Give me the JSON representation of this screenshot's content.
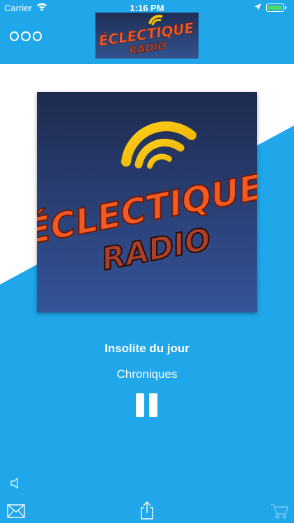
{
  "status_bar": {
    "carrier": "Carrier",
    "time": "1:16 PM",
    "battery_percent": 100
  },
  "header": {
    "menu_icon": "more-circles-icon",
    "logo_icon": "eclectique-radio-logo"
  },
  "player": {
    "title": "Insolite du jour",
    "subtitle": "Chroniques",
    "state": "playing",
    "control_icon": "pause-icon"
  },
  "toolbar": {
    "volume_icon": "speaker-icon",
    "mail_icon": "mail-icon",
    "share_icon": "share-icon",
    "cart_icon": "cart-icon"
  },
  "colors": {
    "accent": "#1fa7ea",
    "background": "#ffffff",
    "logo_bg": "#2a3f7a",
    "logo_text": "#f05a2a",
    "logo_wave": "#f5c400"
  }
}
